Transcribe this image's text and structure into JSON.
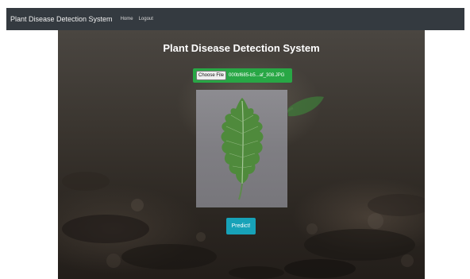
{
  "navbar": {
    "brand": "Plant Disease Detection System",
    "links": [
      "Home",
      "Logout"
    ]
  },
  "main": {
    "title": "Plant Disease Detection System",
    "file_input": {
      "button_label": "Choose File",
      "file_name": "000bf685-b5...af_308.JPG"
    },
    "preview_image": "tomato-leaf-image",
    "predict_label": "Predict!"
  },
  "colors": {
    "navbar_bg": "#343a40",
    "file_bar": "#28a745",
    "predict_button": "#17a2b8"
  }
}
